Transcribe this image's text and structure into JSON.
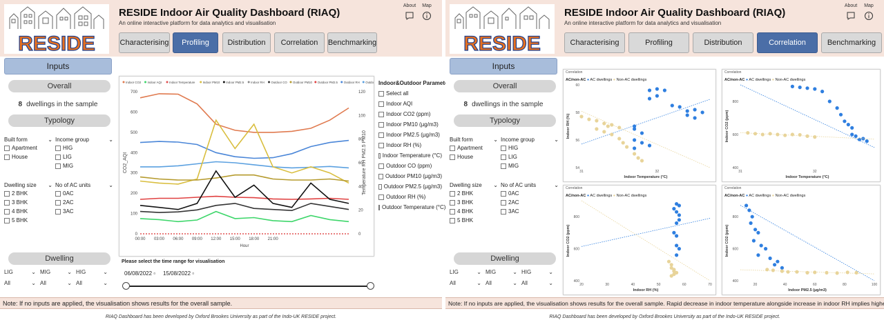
{
  "app": {
    "title": "RESIDE Indoor Air Quality Dashboard (RIAQ)",
    "subtitle": "An online interactive platform for data analytics and visualisation",
    "logo_text": "RESIDE",
    "about_label": "About",
    "map_label": "Map"
  },
  "nav": {
    "characterising": "Characterising",
    "profiling": "Profiling",
    "distribution": "Distribution",
    "correlation": "Correlation",
    "benchmarking": "Benchmarking"
  },
  "sidebar": {
    "inputs_title": "Inputs",
    "overall_label": "Overall",
    "dwellings_count": "8",
    "dwellings_text": "dwellings in the sample",
    "typology_label": "Typology",
    "built_form_label": "Built form",
    "built_form_options": [
      "Apartment",
      "House"
    ],
    "income_group_label": "Income group",
    "income_group_options": [
      "HIG",
      "LIG",
      "MIG"
    ],
    "dwelling_size_label": "Dwelling size",
    "dwelling_size_options": [
      "2 BHK",
      "3 BHK",
      "4 BHK",
      "5 BHK"
    ],
    "ac_units_label": "No of AC units",
    "ac_units_options": [
      "0AC",
      "2AC",
      "3AC"
    ],
    "dwelling_label": "Dwelling",
    "dwelling_groups": [
      "LIG",
      "MIG",
      "HIG"
    ],
    "dwelling_values": [
      "All",
      "All",
      "All"
    ]
  },
  "profiling": {
    "legend": [
      "Indoor CO2",
      "Indoor AQI",
      "Indoor Temperature",
      "Indoor PM10",
      "Indoor PM2.5",
      "Indoor RH",
      "Outdoor CO",
      "Outdoor PM10",
      "Outdoor PM2.5",
      "Outdoor RH",
      "Outdoor Temperature"
    ],
    "params_title": "Indoor&Outdoor Parameters",
    "params": [
      "Select all",
      "Indoor AQI",
      "Indoor CO2 (ppm)",
      "Indoor PM10 (µg/m3)",
      "Indoor PM2.5 (µg/m3)",
      "Indoor RH (%)",
      "Indoor Temperature (°C)",
      "Outdoor CO (ppm)",
      "Outdoor PM10 (µg/m3)",
      "Outdoor PM2.5 (µg/m3)",
      "Outdoor RH (%)",
      "Outdoor Temperature (°C)"
    ],
    "time_range_label": "Please select the time range for visualisation",
    "date_from": "06/08/2022",
    "date_to": "15/08/2022"
  },
  "chart_data": [
    {
      "type": "line",
      "title": "",
      "xlabel": "Hour",
      "ylabel": "CO2_AQI",
      "ylabel_right": "Temperature RH PM2.5 PM10",
      "x": [
        "00:00",
        "03:00",
        "06:00",
        "09:00",
        "12:00",
        "15:00",
        "18:00",
        "21:00"
      ],
      "ylim": [
        0,
        700
      ],
      "ylim_right": [
        0,
        120
      ],
      "y_ticks": [
        0,
        100,
        200,
        300,
        400,
        500,
        600,
        700
      ],
      "y_ticks_right": [
        0,
        20,
        40,
        60,
        80,
        100,
        120
      ],
      "series": [
        {
          "name": "Indoor CO2",
          "color": "#e07a4f",
          "values": [
            670,
            690,
            688,
            640,
            540,
            510,
            500,
            500,
            505,
            520,
            560,
            620
          ]
        },
        {
          "name": "Outdoor RH",
          "color": "#4a86d8",
          "values": [
            450,
            455,
            452,
            440,
            400,
            380,
            372,
            375,
            395,
            430,
            450,
            460
          ]
        },
        {
          "name": "Outdoor Temperature",
          "color": "#5aa0e0",
          "values": [
            330,
            330,
            335,
            345,
            355,
            350,
            340,
            330,
            325,
            328,
            332,
            325
          ]
        },
        {
          "name": "Indoor PM10",
          "color": "#d9be3f",
          "values": [
            260,
            250,
            245,
            270,
            560,
            420,
            540,
            330,
            300,
            330,
            300,
            250
          ]
        },
        {
          "name": "Outdoor PM10",
          "color": "#b59a2c",
          "values": [
            280,
            270,
            265,
            265,
            275,
            290,
            290,
            270,
            265,
            265,
            270,
            260
          ]
        },
        {
          "name": "Outdoor PM2.5",
          "color": "#e04040",
          "values": [
            170,
            175,
            175,
            180,
            185,
            180,
            178,
            172,
            170,
            172,
            175,
            170
          ]
        },
        {
          "name": "Indoor PM2.5",
          "color": "#111111",
          "values": [
            140,
            130,
            120,
            150,
            310,
            180,
            240,
            150,
            130,
            250,
            170,
            150
          ]
        },
        {
          "name": "Outdoor CO",
          "color": "#333333",
          "values": [
            110,
            105,
            108,
            118,
            140,
            150,
            125,
            120,
            115,
            150,
            135,
            120
          ]
        },
        {
          "name": "Indoor AQI",
          "color": "#3dd66a",
          "values": [
            75,
            70,
            60,
            68,
            110,
            75,
            80,
            65,
            60,
            90,
            70,
            60
          ]
        },
        {
          "name": "Indoor Temperature",
          "color": "#e05050",
          "values": [
            0,
            0,
            0,
            0,
            0,
            0,
            0,
            0,
            0,
            0,
            0,
            0
          ]
        }
      ]
    },
    {
      "type": "scatter",
      "title": "Correlation",
      "legend_title": "AC/non-AC",
      "legend": [
        "AC dwellings",
        "Non-AC dwellings"
      ],
      "xlabel": "Indoor Temperature (°C)",
      "ylabel": "Indoor RH (%)",
      "xlim": [
        31,
        32.7
      ],
      "ylim": [
        54,
        60
      ],
      "x_ticks": [
        31,
        32
      ],
      "y_ticks": [
        54,
        56,
        58,
        60
      ],
      "series": [
        {
          "name": "AC dwellings",
          "color": "#2f7fe0",
          "points": [
            [
              31.9,
              59.6
            ],
            [
              32.0,
              59.7
            ],
            [
              32.1,
              59.6
            ],
            [
              32.0,
              59.2
            ],
            [
              31.9,
              59.0
            ],
            [
              32.2,
              58.5
            ],
            [
              32.3,
              58.4
            ],
            [
              32.4,
              58.1
            ],
            [
              32.5,
              58.2
            ],
            [
              32.6,
              58.0
            ],
            [
              32.4,
              57.8
            ],
            [
              32.5,
              57.6
            ],
            [
              31.7,
              57.0
            ],
            [
              31.7,
              56.8
            ],
            [
              31.8,
              56.5
            ],
            [
              31.7,
              56.0
            ],
            [
              31.8,
              55.8
            ],
            [
              31.9,
              55.6
            ],
            [
              31.7,
              55.4
            ]
          ]
        },
        {
          "name": "Non-AC dwellings",
          "color": "#e8d49a",
          "points": [
            [
              31.0,
              57.7
            ],
            [
              31.1,
              57.5
            ],
            [
              31.2,
              57.4
            ],
            [
              31.3,
              57.2
            ],
            [
              31.35,
              57.0
            ],
            [
              31.2,
              56.8
            ],
            [
              31.3,
              56.6
            ],
            [
              31.4,
              56.4
            ],
            [
              31.5,
              56.1
            ],
            [
              31.55,
              55.8
            ],
            [
              31.6,
              55.5
            ],
            [
              31.7,
              55.0
            ],
            [
              31.75,
              54.7
            ],
            [
              31.8,
              54.5
            ],
            [
              31.5,
              56.9
            ],
            [
              31.4,
              57.1
            ]
          ]
        }
      ]
    },
    {
      "type": "scatter",
      "title": "Correlation",
      "legend_title": "AC/non-AC",
      "legend": [
        "AC dwellings",
        "Non-AC dwellings"
      ],
      "xlabel": "Indoor Temperature (°C)",
      "ylabel": "Indoor CO2 (ppm)",
      "xlim": [
        31,
        32.8
      ],
      "ylim": [
        400,
        900
      ],
      "x_ticks": [
        31,
        32
      ],
      "y_ticks": [
        400,
        600,
        800
      ],
      "series": [
        {
          "name": "AC dwellings",
          "color": "#2f7fe0",
          "points": [
            [
              31.7,
              890
            ],
            [
              31.8,
              885
            ],
            [
              31.9,
              880
            ],
            [
              32.0,
              875
            ],
            [
              32.1,
              860
            ],
            [
              32.2,
              800
            ],
            [
              32.3,
              760
            ],
            [
              32.35,
              720
            ],
            [
              32.4,
              680
            ],
            [
              32.45,
              660
            ],
            [
              32.5,
              640
            ],
            [
              32.5,
              600
            ],
            [
              32.55,
              590
            ],
            [
              32.6,
              570
            ],
            [
              32.65,
              575
            ],
            [
              32.7,
              560
            ]
          ]
        },
        {
          "name": "Non-AC dwellings",
          "color": "#e8d49a",
          "points": [
            [
              31.1,
              610
            ],
            [
              31.2,
              605
            ],
            [
              31.3,
              600
            ],
            [
              31.4,
              605
            ],
            [
              31.5,
              600
            ],
            [
              31.6,
              595
            ],
            [
              31.7,
              600
            ],
            [
              31.8,
              598
            ],
            [
              31.9,
              590
            ],
            [
              32.0,
              585
            ]
          ]
        }
      ]
    },
    {
      "type": "scatter",
      "title": "Correlation",
      "legend_title": "AC/non-AC",
      "legend": [
        "AC dwellings",
        "Non-AC dwellings"
      ],
      "xlabel": "Indoor RH (%)",
      "ylabel": "Indoor CO2 (ppm)",
      "xlim": [
        20,
        70
      ],
      "ylim": [
        400,
        900
      ],
      "x_ticks": [
        20,
        30,
        40,
        50,
        60,
        70
      ],
      "y_ticks": [
        400,
        600,
        800
      ],
      "series": [
        {
          "name": "AC dwellings",
          "color": "#2f7fe0",
          "points": [
            [
              57,
              880
            ],
            [
              58,
              870
            ],
            [
              56,
              850
            ],
            [
              57,
              830
            ],
            [
              58,
              810
            ],
            [
              58,
              780
            ],
            [
              57,
              760
            ],
            [
              56,
              700
            ],
            [
              57,
              680
            ],
            [
              57,
              620
            ],
            [
              58,
              600
            ],
            [
              57,
              560
            ]
          ]
        },
        {
          "name": "Non-AC dwellings",
          "color": "#e8d49a",
          "points": [
            [
              54,
              520
            ],
            [
              55,
              500
            ],
            [
              55,
              480
            ],
            [
              56,
              470
            ],
            [
              56,
              460
            ],
            [
              57,
              450
            ],
            [
              56,
              440
            ],
            [
              55,
              430
            ]
          ]
        }
      ]
    },
    {
      "type": "scatter",
      "title": "Correlation",
      "legend_title": "AC/non-AC",
      "legend": [
        "AC dwellings",
        "Non-AC dwellings"
      ],
      "xlabel": "Indoor PM2.5 (µg/m3)",
      "ylabel": "Indoor CO2 (ppm)",
      "xlim": [
        10,
        100
      ],
      "ylim": [
        400,
        900
      ],
      "x_ticks": [
        20,
        40,
        60,
        80,
        100
      ],
      "y_ticks": [
        400,
        600,
        800
      ],
      "series": [
        {
          "name": "AC dwellings",
          "color": "#2f7fe0",
          "points": [
            [
              14,
              870
            ],
            [
              16,
              840
            ],
            [
              18,
              800
            ],
            [
              17,
              760
            ],
            [
              20,
              720
            ],
            [
              22,
              700
            ],
            [
              19,
              650
            ],
            [
              24,
              620
            ],
            [
              27,
              600
            ],
            [
              22,
              560
            ],
            [
              30,
              540
            ],
            [
              35,
              520
            ],
            [
              33,
              500
            ],
            [
              38,
              480
            ]
          ]
        },
        {
          "name": "Non-AC dwellings",
          "color": "#e8d49a",
          "points": [
            [
              28,
              470
            ],
            [
              32,
              465
            ],
            [
              38,
              460
            ],
            [
              42,
              455
            ],
            [
              48,
              455
            ],
            [
              55,
              450
            ],
            [
              60,
              452
            ],
            [
              68,
              450
            ],
            [
              75,
              448
            ],
            [
              82,
              452
            ],
            [
              88,
              450
            ]
          ]
        }
      ]
    }
  ],
  "left_panel": {
    "note": "Note: If no inputs are applied, the visualisation shows results for the overall sample.",
    "footer": "RIAQ Dashboard has been developed by Oxford Brookes University as part of the Indo-UK RESIDE project."
  },
  "right_panel": {
    "note": "Note: If no inputs are applied, the visualisation shows results for the overall sample. Rapid decrease in indoor temperature alongside increase in indoor RH implies higher AC use.",
    "footer": "RIAQ Dashboard has been developed by Oxford Brookes University as part of the Indo-UK RESIDE project."
  }
}
